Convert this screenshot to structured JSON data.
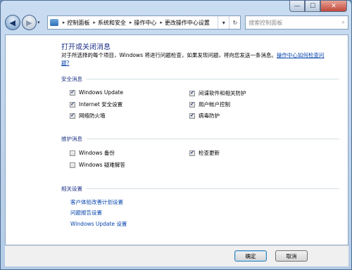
{
  "window": {
    "min_glyph": "—",
    "max_glyph": "☐",
    "close_glyph": "✕"
  },
  "nav": {
    "back_glyph": "◀",
    "forward_glyph": "▶",
    "breadcrumb": [
      "控制面板",
      "系统和安全",
      "操作中心",
      "更改操作中心设置"
    ],
    "sep_glyph": "▸",
    "search_placeholder": "搜索控制面板"
  },
  "main": {
    "title": "打开或关闭消息",
    "description": "对于所选择的每个项目，Windows 将进行问题检查，如果发现问题，将向您发送一条消息。",
    "help_link": "操作中心如何检查问题?",
    "security": {
      "heading": "安全消息",
      "items": [
        {
          "label": "Windows Update",
          "checked": true
        },
        {
          "label": "Internet 安全设置",
          "checked": true
        },
        {
          "label": "网络防火墙",
          "checked": true
        },
        {
          "label": "间谍软件和相关防护",
          "checked": true
        },
        {
          "label": "用户帐户控制",
          "checked": true
        },
        {
          "label": "病毒防护",
          "checked": true
        }
      ]
    },
    "maintenance": {
      "heading": "维护消息",
      "items": [
        {
          "label": "Windows 备份",
          "checked": false
        },
        {
          "label": "Windows 疑难解答",
          "checked": false
        },
        {
          "label": "检查更新",
          "checked": true
        }
      ]
    },
    "related": {
      "heading": "相关设置",
      "links": [
        "客户体验改善计划设置",
        "问题报告设置",
        "Windows Update 设置"
      ]
    }
  },
  "footer": {
    "ok_label": "确定",
    "cancel_label": "取消"
  },
  "check_glyph": "✔"
}
